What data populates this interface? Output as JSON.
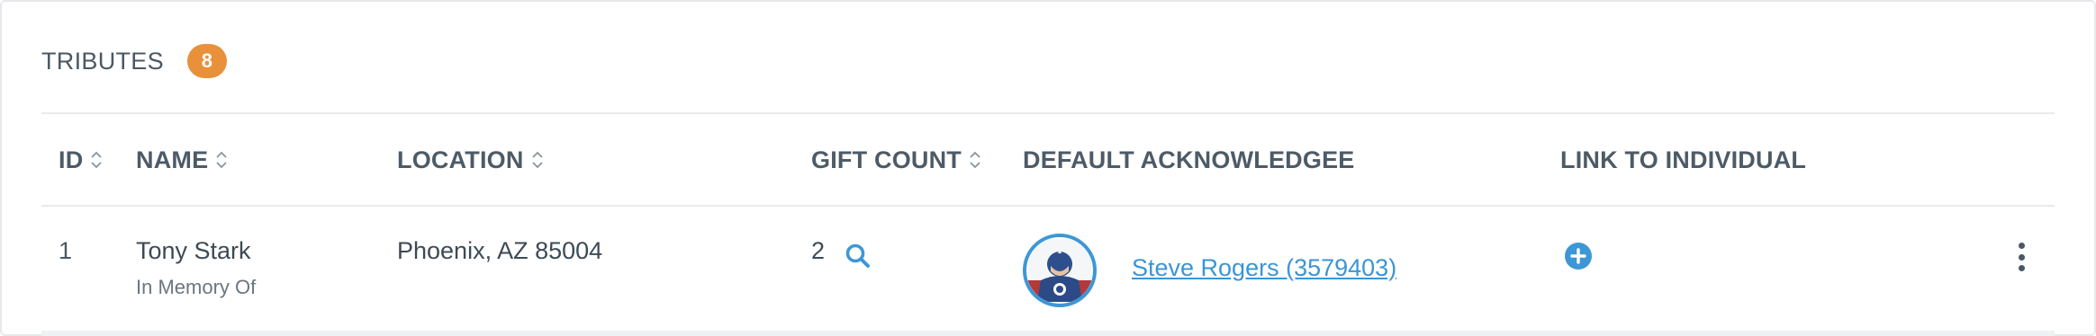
{
  "header": {
    "title": "TRIBUTES",
    "count": "8"
  },
  "table": {
    "columns": {
      "id": "ID",
      "name": "NAME",
      "location": "LOCATION",
      "gift_count": "GIFT COUNT",
      "default_acknowledgee": "DEFAULT ACKNOWLEDGEE",
      "link_to_individual": "LINK TO INDIVIDUAL"
    },
    "rows": [
      {
        "id": "1",
        "name": "Tony Stark",
        "tribute_type": "In Memory Of",
        "location": "Phoenix, AZ 85004",
        "gift_count": "2",
        "acknowledgee": "Steve Rogers (3579403)"
      }
    ]
  },
  "colors": {
    "badge": "#e8913a",
    "link": "#3b95d6",
    "icon_blue": "#3d97d6"
  },
  "icons": {
    "sort": "sort-icon",
    "search": "search-icon",
    "add": "plus-circle-icon",
    "more": "kebab-menu-icon"
  }
}
